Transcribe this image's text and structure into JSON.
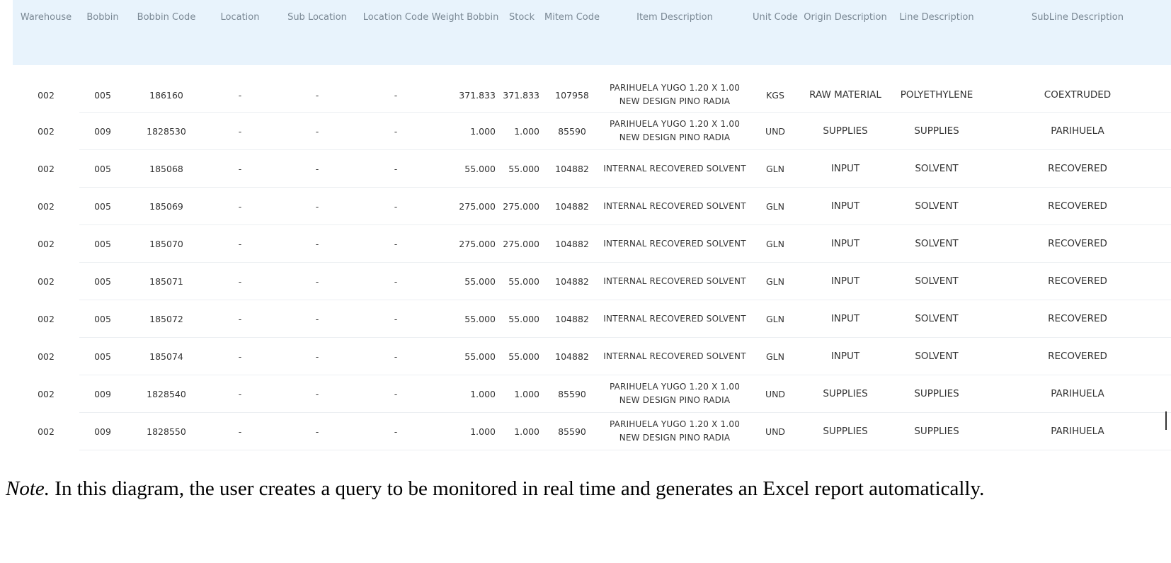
{
  "table": {
    "columns": [
      "Warehouse",
      "Bobbin",
      "Bobbin Code",
      "Location",
      "Sub Location",
      "Location Code",
      "Weight Bobbin",
      "Stock",
      "Mitem Code",
      "Item Description",
      "Unit Code",
      "Origin Description",
      "Line Description",
      "SubLine Description"
    ],
    "rows": [
      {
        "warehouse": "002",
        "bobbin": "005",
        "bobbin_code": "186160",
        "location": "-",
        "sub_location": "-",
        "location_code": "-",
        "weight_bobbin": "371.833",
        "stock": "371.833",
        "mitem_code": "107958",
        "item_description": "PARIHUELA YUGO 1.20 X 1.00 NEW DESIGN PINO RADIA",
        "unit_code": "KGS",
        "origin_description": "RAW MATERIAL",
        "line_description": "POLYETHYLENE",
        "subline_description": "COEXTRUDED"
      },
      {
        "warehouse": "002",
        "bobbin": "009",
        "bobbin_code": "1828530",
        "location": "-",
        "sub_location": "-",
        "location_code": "-",
        "weight_bobbin": "1.000",
        "stock": "1.000",
        "mitem_code": "85590",
        "item_description": "PARIHUELA YUGO 1.20 X 1.00 NEW DESIGN PINO RADIA",
        "unit_code": "UND",
        "origin_description": "SUPPLIES",
        "line_description": "SUPPLIES",
        "subline_description": "PARIHUELA"
      },
      {
        "warehouse": "002",
        "bobbin": "005",
        "bobbin_code": "185068",
        "location": "-",
        "sub_location": "-",
        "location_code": "-",
        "weight_bobbin": "55.000",
        "stock": "55.000",
        "mitem_code": "104882",
        "item_description": "INTERNAL RECOVERED SOLVENT",
        "unit_code": "GLN",
        "origin_description": "INPUT",
        "line_description": "SOLVENT",
        "subline_description": "RECOVERED"
      },
      {
        "warehouse": "002",
        "bobbin": "005",
        "bobbin_code": "185069",
        "location": "-",
        "sub_location": "-",
        "location_code": "-",
        "weight_bobbin": "275.000",
        "stock": "275.000",
        "mitem_code": "104882",
        "item_description": "INTERNAL RECOVERED SOLVENT",
        "unit_code": "GLN",
        "origin_description": "INPUT",
        "line_description": "SOLVENT",
        "subline_description": "RECOVERED"
      },
      {
        "warehouse": "002",
        "bobbin": "005",
        "bobbin_code": "185070",
        "location": "-",
        "sub_location": "-",
        "location_code": "-",
        "weight_bobbin": "275.000",
        "stock": "275.000",
        "mitem_code": "104882",
        "item_description": "INTERNAL RECOVERED SOLVENT",
        "unit_code": "GLN",
        "origin_description": "INPUT",
        "line_description": "SOLVENT",
        "subline_description": "RECOVERED"
      },
      {
        "warehouse": "002",
        "bobbin": "005",
        "bobbin_code": "185071",
        "location": "-",
        "sub_location": "-",
        "location_code": "-",
        "weight_bobbin": "55.000",
        "stock": "55.000",
        "mitem_code": "104882",
        "item_description": "INTERNAL RECOVERED SOLVENT",
        "unit_code": "GLN",
        "origin_description": "INPUT",
        "line_description": "SOLVENT",
        "subline_description": "RECOVERED"
      },
      {
        "warehouse": "002",
        "bobbin": "005",
        "bobbin_code": "185072",
        "location": "-",
        "sub_location": "-",
        "location_code": "-",
        "weight_bobbin": "55.000",
        "stock": "55.000",
        "mitem_code": "104882",
        "item_description": "INTERNAL RECOVERED SOLVENT",
        "unit_code": "GLN",
        "origin_description": "INPUT",
        "line_description": "SOLVENT",
        "subline_description": "RECOVERED"
      },
      {
        "warehouse": "002",
        "bobbin": "005",
        "bobbin_code": "185074",
        "location": "-",
        "sub_location": "-",
        "location_code": "-",
        "weight_bobbin": "55.000",
        "stock": "55.000",
        "mitem_code": "104882",
        "item_description": "INTERNAL RECOVERED SOLVENT",
        "unit_code": "GLN",
        "origin_description": "INPUT",
        "line_description": "SOLVENT",
        "subline_description": "RECOVERED"
      },
      {
        "warehouse": "002",
        "bobbin": "009",
        "bobbin_code": "1828540",
        "location": "-",
        "sub_location": "-",
        "location_code": "-",
        "weight_bobbin": "1.000",
        "stock": "1.000",
        "mitem_code": "85590",
        "item_description": "PARIHUELA YUGO 1.20 X 1.00 NEW DESIGN PINO RADIA",
        "unit_code": "UND",
        "origin_description": "SUPPLIES",
        "line_description": "SUPPLIES",
        "subline_description": "PARIHUELA"
      },
      {
        "warehouse": "002",
        "bobbin": "009",
        "bobbin_code": "1828550",
        "location": "-",
        "sub_location": "-",
        "location_code": "-",
        "weight_bobbin": "1.000",
        "stock": "1.000",
        "mitem_code": "85590",
        "item_description": "PARIHUELA YUGO 1.20 X 1.00 NEW DESIGN PINO RADIA",
        "unit_code": "UND",
        "origin_description": "SUPPLIES",
        "line_description": "SUPPLIES",
        "subline_description": "PARIHUELA"
      }
    ]
  },
  "note": {
    "label": "Note.",
    "text": " In this diagram, the user creates a query to be monitored in real time and generates an Excel report automatically."
  },
  "colors": {
    "header_background": "#e8f3fc",
    "header_text": "#7a8894",
    "row_divider": "#eceff2"
  }
}
